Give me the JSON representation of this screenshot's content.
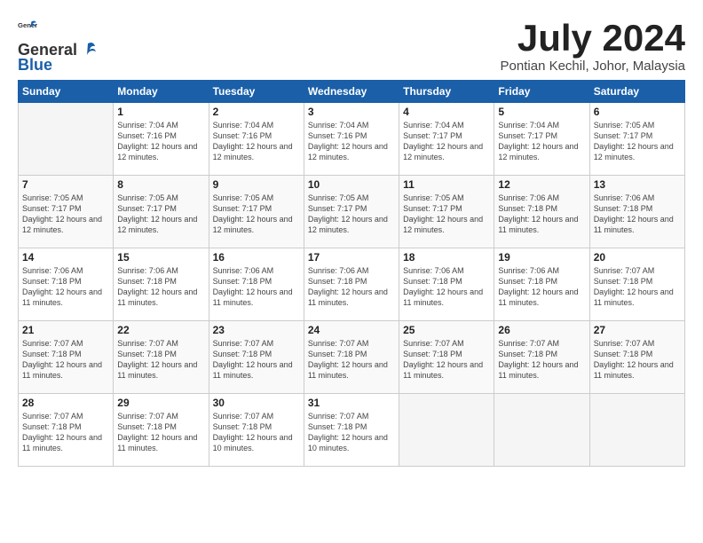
{
  "logo": {
    "general": "General",
    "blue": "Blue"
  },
  "title": "July 2024",
  "location": "Pontian Kechil, Johor, Malaysia",
  "days_of_week": [
    "Sunday",
    "Monday",
    "Tuesday",
    "Wednesday",
    "Thursday",
    "Friday",
    "Saturday"
  ],
  "weeks": [
    [
      {
        "day": "",
        "empty": true
      },
      {
        "day": "1",
        "sunrise": "Sunrise: 7:04 AM",
        "sunset": "Sunset: 7:16 PM",
        "daylight": "Daylight: 12 hours and 12 minutes."
      },
      {
        "day": "2",
        "sunrise": "Sunrise: 7:04 AM",
        "sunset": "Sunset: 7:16 PM",
        "daylight": "Daylight: 12 hours and 12 minutes."
      },
      {
        "day": "3",
        "sunrise": "Sunrise: 7:04 AM",
        "sunset": "Sunset: 7:16 PM",
        "daylight": "Daylight: 12 hours and 12 minutes."
      },
      {
        "day": "4",
        "sunrise": "Sunrise: 7:04 AM",
        "sunset": "Sunset: 7:17 PM",
        "daylight": "Daylight: 12 hours and 12 minutes."
      },
      {
        "day": "5",
        "sunrise": "Sunrise: 7:04 AM",
        "sunset": "Sunset: 7:17 PM",
        "daylight": "Daylight: 12 hours and 12 minutes."
      },
      {
        "day": "6",
        "sunrise": "Sunrise: 7:05 AM",
        "sunset": "Sunset: 7:17 PM",
        "daylight": "Daylight: 12 hours and 12 minutes."
      }
    ],
    [
      {
        "day": "7",
        "sunrise": "Sunrise: 7:05 AM",
        "sunset": "Sunset: 7:17 PM",
        "daylight": "Daylight: 12 hours and 12 minutes."
      },
      {
        "day": "8",
        "sunrise": "Sunrise: 7:05 AM",
        "sunset": "Sunset: 7:17 PM",
        "daylight": "Daylight: 12 hours and 12 minutes."
      },
      {
        "day": "9",
        "sunrise": "Sunrise: 7:05 AM",
        "sunset": "Sunset: 7:17 PM",
        "daylight": "Daylight: 12 hours and 12 minutes."
      },
      {
        "day": "10",
        "sunrise": "Sunrise: 7:05 AM",
        "sunset": "Sunset: 7:17 PM",
        "daylight": "Daylight: 12 hours and 12 minutes."
      },
      {
        "day": "11",
        "sunrise": "Sunrise: 7:05 AM",
        "sunset": "Sunset: 7:17 PM",
        "daylight": "Daylight: 12 hours and 12 minutes."
      },
      {
        "day": "12",
        "sunrise": "Sunrise: 7:06 AM",
        "sunset": "Sunset: 7:18 PM",
        "daylight": "Daylight: 12 hours and 11 minutes."
      },
      {
        "day": "13",
        "sunrise": "Sunrise: 7:06 AM",
        "sunset": "Sunset: 7:18 PM",
        "daylight": "Daylight: 12 hours and 11 minutes."
      }
    ],
    [
      {
        "day": "14",
        "sunrise": "Sunrise: 7:06 AM",
        "sunset": "Sunset: 7:18 PM",
        "daylight": "Daylight: 12 hours and 11 minutes."
      },
      {
        "day": "15",
        "sunrise": "Sunrise: 7:06 AM",
        "sunset": "Sunset: 7:18 PM",
        "daylight": "Daylight: 12 hours and 11 minutes."
      },
      {
        "day": "16",
        "sunrise": "Sunrise: 7:06 AM",
        "sunset": "Sunset: 7:18 PM",
        "daylight": "Daylight: 12 hours and 11 minutes."
      },
      {
        "day": "17",
        "sunrise": "Sunrise: 7:06 AM",
        "sunset": "Sunset: 7:18 PM",
        "daylight": "Daylight: 12 hours and 11 minutes."
      },
      {
        "day": "18",
        "sunrise": "Sunrise: 7:06 AM",
        "sunset": "Sunset: 7:18 PM",
        "daylight": "Daylight: 12 hours and 11 minutes."
      },
      {
        "day": "19",
        "sunrise": "Sunrise: 7:06 AM",
        "sunset": "Sunset: 7:18 PM",
        "daylight": "Daylight: 12 hours and 11 minutes."
      },
      {
        "day": "20",
        "sunrise": "Sunrise: 7:07 AM",
        "sunset": "Sunset: 7:18 PM",
        "daylight": "Daylight: 12 hours and 11 minutes."
      }
    ],
    [
      {
        "day": "21",
        "sunrise": "Sunrise: 7:07 AM",
        "sunset": "Sunset: 7:18 PM",
        "daylight": "Daylight: 12 hours and 11 minutes."
      },
      {
        "day": "22",
        "sunrise": "Sunrise: 7:07 AM",
        "sunset": "Sunset: 7:18 PM",
        "daylight": "Daylight: 12 hours and 11 minutes."
      },
      {
        "day": "23",
        "sunrise": "Sunrise: 7:07 AM",
        "sunset": "Sunset: 7:18 PM",
        "daylight": "Daylight: 12 hours and 11 minutes."
      },
      {
        "day": "24",
        "sunrise": "Sunrise: 7:07 AM",
        "sunset": "Sunset: 7:18 PM",
        "daylight": "Daylight: 12 hours and 11 minutes."
      },
      {
        "day": "25",
        "sunrise": "Sunrise: 7:07 AM",
        "sunset": "Sunset: 7:18 PM",
        "daylight": "Daylight: 12 hours and 11 minutes."
      },
      {
        "day": "26",
        "sunrise": "Sunrise: 7:07 AM",
        "sunset": "Sunset: 7:18 PM",
        "daylight": "Daylight: 12 hours and 11 minutes."
      },
      {
        "day": "27",
        "sunrise": "Sunrise: 7:07 AM",
        "sunset": "Sunset: 7:18 PM",
        "daylight": "Daylight: 12 hours and 11 minutes."
      }
    ],
    [
      {
        "day": "28",
        "sunrise": "Sunrise: 7:07 AM",
        "sunset": "Sunset: 7:18 PM",
        "daylight": "Daylight: 12 hours and 11 minutes."
      },
      {
        "day": "29",
        "sunrise": "Sunrise: 7:07 AM",
        "sunset": "Sunset: 7:18 PM",
        "daylight": "Daylight: 12 hours and 11 minutes."
      },
      {
        "day": "30",
        "sunrise": "Sunrise: 7:07 AM",
        "sunset": "Sunset: 7:18 PM",
        "daylight": "Daylight: 12 hours and 10 minutes."
      },
      {
        "day": "31",
        "sunrise": "Sunrise: 7:07 AM",
        "sunset": "Sunset: 7:18 PM",
        "daylight": "Daylight: 12 hours and 10 minutes."
      },
      {
        "day": "",
        "empty": true
      },
      {
        "day": "",
        "empty": true
      },
      {
        "day": "",
        "empty": true
      }
    ]
  ]
}
